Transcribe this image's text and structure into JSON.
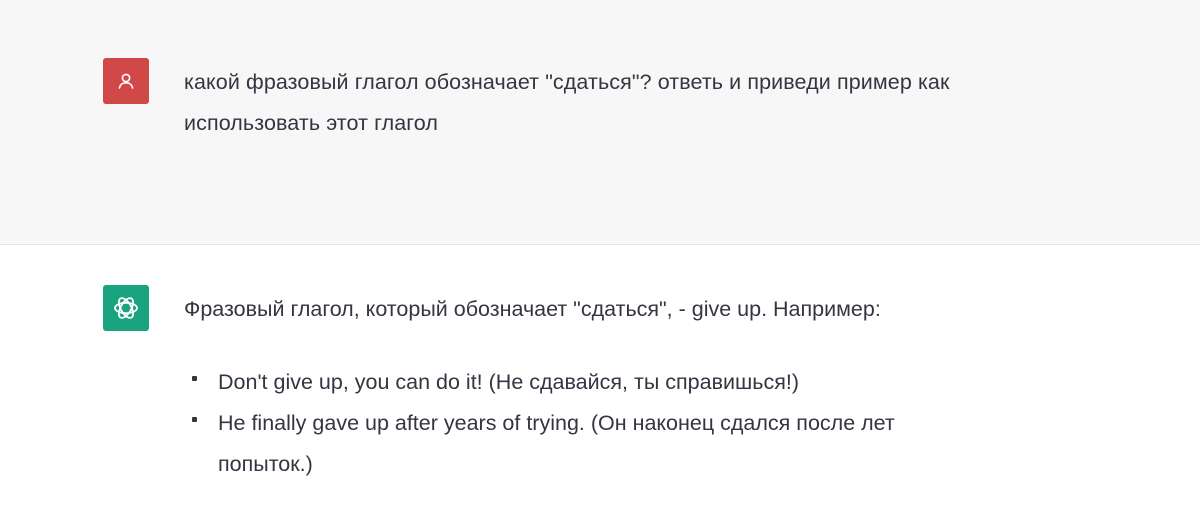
{
  "user_message": {
    "avatar_icon": "user-icon",
    "avatar_color": "#d04848",
    "text": "какой фразовый глагол обозначает \"сдаться\"? ответь и приведи пример как использовать этот глагол"
  },
  "assistant_message": {
    "avatar_icon": "openai-logo-icon",
    "avatar_color": "#1aa37f",
    "intro": "Фразовый глагол, который обозначает \"сдаться\", - give up. Например:",
    "examples": [
      "Don't give up, you can do it! (Не сдавайся, ты справишься!)",
      "He finally gave up after years of trying. (Он наконец сдался после лет попыток.)"
    ]
  }
}
